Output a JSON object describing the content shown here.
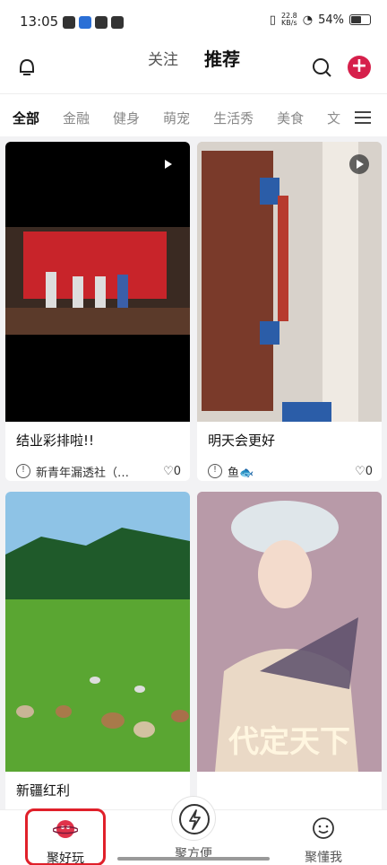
{
  "status_bar": {
    "time": "13:05",
    "net_speed_top": "22.8",
    "net_speed_unit": "KB/s",
    "battery": "54%"
  },
  "header": {
    "tab_follow": "关注",
    "tab_recommend": "推荐",
    "accent_color": "#d6204b"
  },
  "categories": [
    "全部",
    "金融",
    "健身",
    "萌宠",
    "生活秀",
    "美食",
    "文"
  ],
  "feed": {
    "cards": [
      {
        "title": "结业彩排啦!!",
        "author": "新青年漏透社（…",
        "likes": "0",
        "is_video": true
      },
      {
        "title": "明天会更好",
        "author": "鱼🐟",
        "likes": "0",
        "is_video": true
      },
      {
        "title": "新疆红利",
        "is_video": false
      },
      {
        "title": "",
        "poster_text": "代定天下",
        "is_video": false
      }
    ]
  },
  "bottom_nav": {
    "items": [
      {
        "label": "聚好玩",
        "icon": "planet-icon",
        "active": true
      },
      {
        "label": "聚方便",
        "icon": "lightning-icon",
        "active": false
      },
      {
        "label": "聚懂我",
        "icon": "smiley-icon",
        "active": false
      }
    ]
  }
}
